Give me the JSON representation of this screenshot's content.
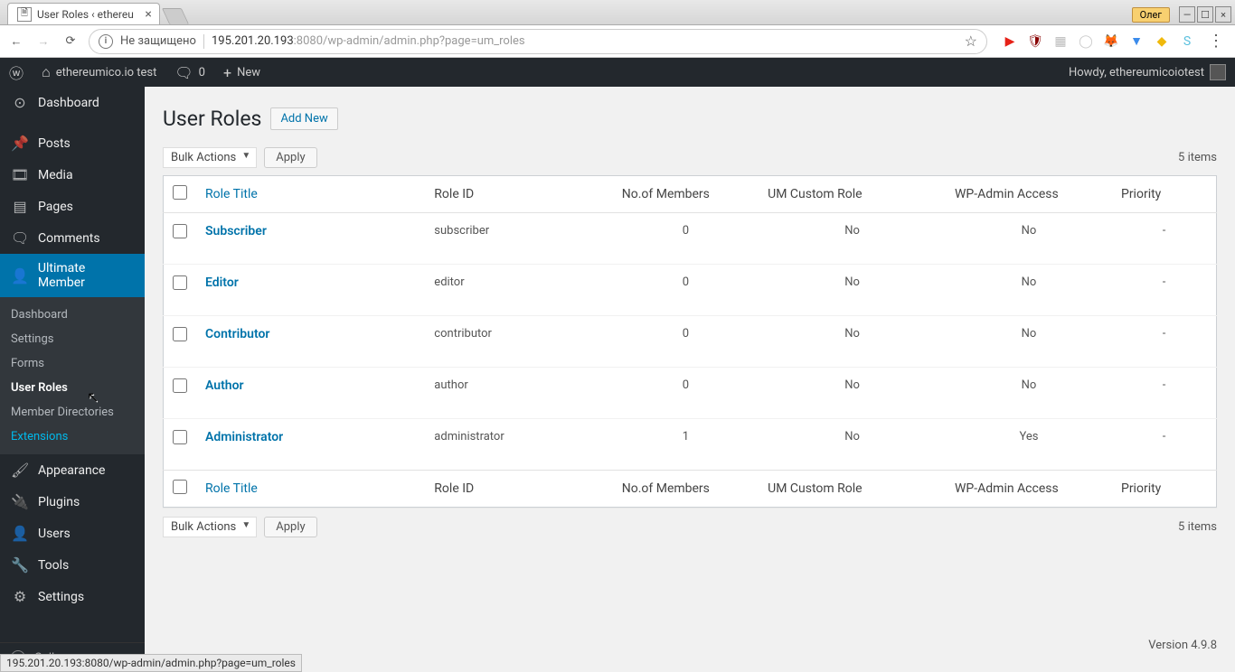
{
  "browser": {
    "tab_title": "User Roles ‹ ethereu",
    "window_user": "Олег",
    "url_label": "Не защищено",
    "url_host": "195.201.20.193",
    "url_port": ":8080",
    "url_path": "/wp-admin/admin.php?page=um_roles",
    "status_bar": "195.201.20.193:8080/wp-admin/admin.php?page=um_roles"
  },
  "adminbar": {
    "site_name": "ethereumico.io test",
    "comment_count": "0",
    "new_label": "New",
    "howdy": "Howdy, ethereumicoiotest"
  },
  "menu": {
    "dashboard": "Dashboard",
    "posts": "Posts",
    "media": "Media",
    "pages": "Pages",
    "comments": "Comments",
    "ultimate_member": "Ultimate Member",
    "sub_dashboard": "Dashboard",
    "sub_settings": "Settings",
    "sub_forms": "Forms",
    "sub_user_roles": "User Roles",
    "sub_member_dirs": "Member Directories",
    "sub_extensions": "Extensions",
    "appearance": "Appearance",
    "plugins": "Plugins",
    "users": "Users",
    "tools": "Tools",
    "settings": "Settings",
    "collapse": "Collapse menu"
  },
  "content": {
    "page_title": "User Roles",
    "add_new": "Add New",
    "bulk_actions": "Bulk Actions",
    "apply": "Apply",
    "items_count": "5 items",
    "columns": {
      "title": "Role Title",
      "id": "Role ID",
      "members": "No.of Members",
      "custom": "UM Custom Role",
      "access": "WP-Admin Access",
      "priority": "Priority"
    },
    "rows": [
      {
        "title": "Subscriber",
        "id": "subscriber",
        "members": "0",
        "custom": "No",
        "access": "No",
        "priority": "-"
      },
      {
        "title": "Editor",
        "id": "editor",
        "members": "0",
        "custom": "No",
        "access": "No",
        "priority": "-"
      },
      {
        "title": "Contributor",
        "id": "contributor",
        "members": "0",
        "custom": "No",
        "access": "No",
        "priority": "-"
      },
      {
        "title": "Author",
        "id": "author",
        "members": "0",
        "custom": "No",
        "access": "No",
        "priority": "-"
      },
      {
        "title": "Administrator",
        "id": "administrator",
        "members": "1",
        "custom": "No",
        "access": "Yes",
        "priority": "-"
      }
    ],
    "footer_version": "Version 4.9.8"
  }
}
